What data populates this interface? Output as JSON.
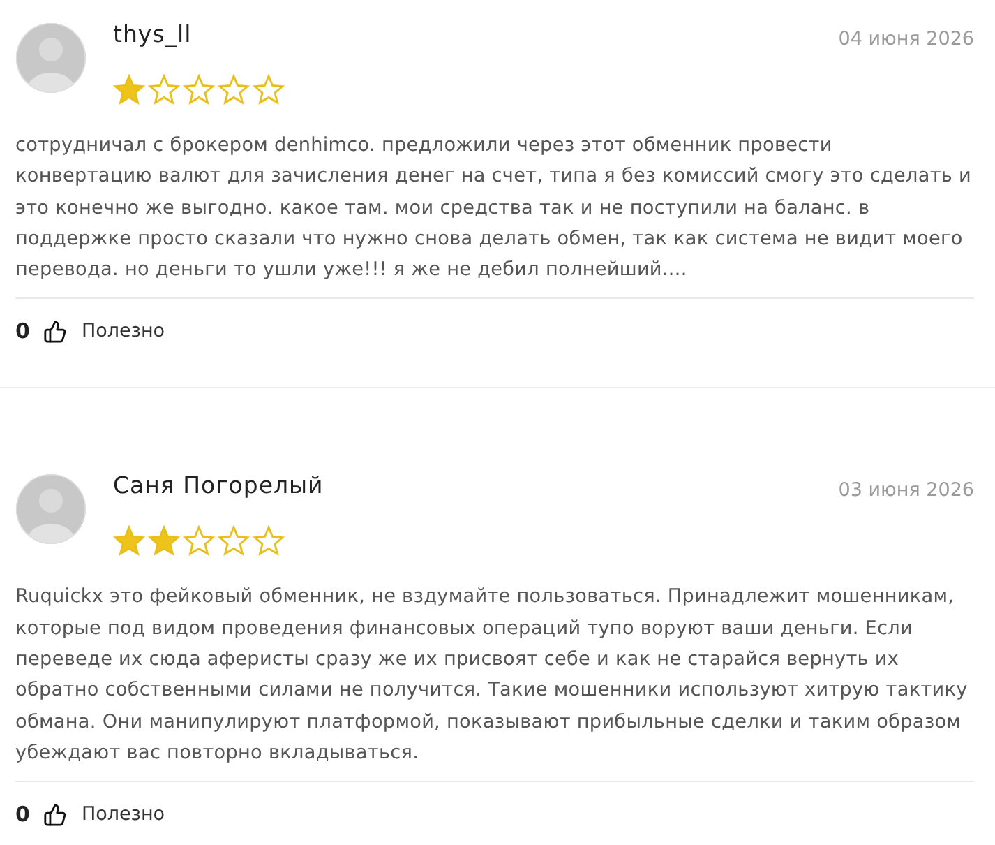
{
  "reviews": [
    {
      "author": "thys_ll",
      "date": "04 июня 2026",
      "stars": 1,
      "text": "сотрудничал с брокером denhimco. предложили через этот обменник провести конвертацию валют для зачисления денег на счет, типа я без комиссий смогу это сделать и это конечно же выгодно. какое там. мои средства так и не поступили на баланс. в поддержке просто сказали что нужно снова делать обмен, так как система не видит моего перевода. но деньги то ушли уже!!! я же не дебил полнейший....",
      "likes": "0",
      "helpful_label": "Полезно"
    },
    {
      "author": "Саня Погорелый",
      "date": "03 июня 2026",
      "stars": 2,
      "text": "Ruquickx это фейковый обменник, не вздумайте пользоваться. Принадлежит мошенникам, которые под видом проведения финансовых операций тупо воруют ваши деньги. Если переведе их сюда аферисты сразу же их присвоят себе и как не старайся вернуть их обратно собственными силами не получится. Такие мошенники используют хитрую тактику обмана. Они манипулируют платформой, показывают прибыльные сделки и таким образом убеждают вас повторно вкладываться.",
      "likes": "0",
      "helpful_label": "Полезно"
    }
  ]
}
